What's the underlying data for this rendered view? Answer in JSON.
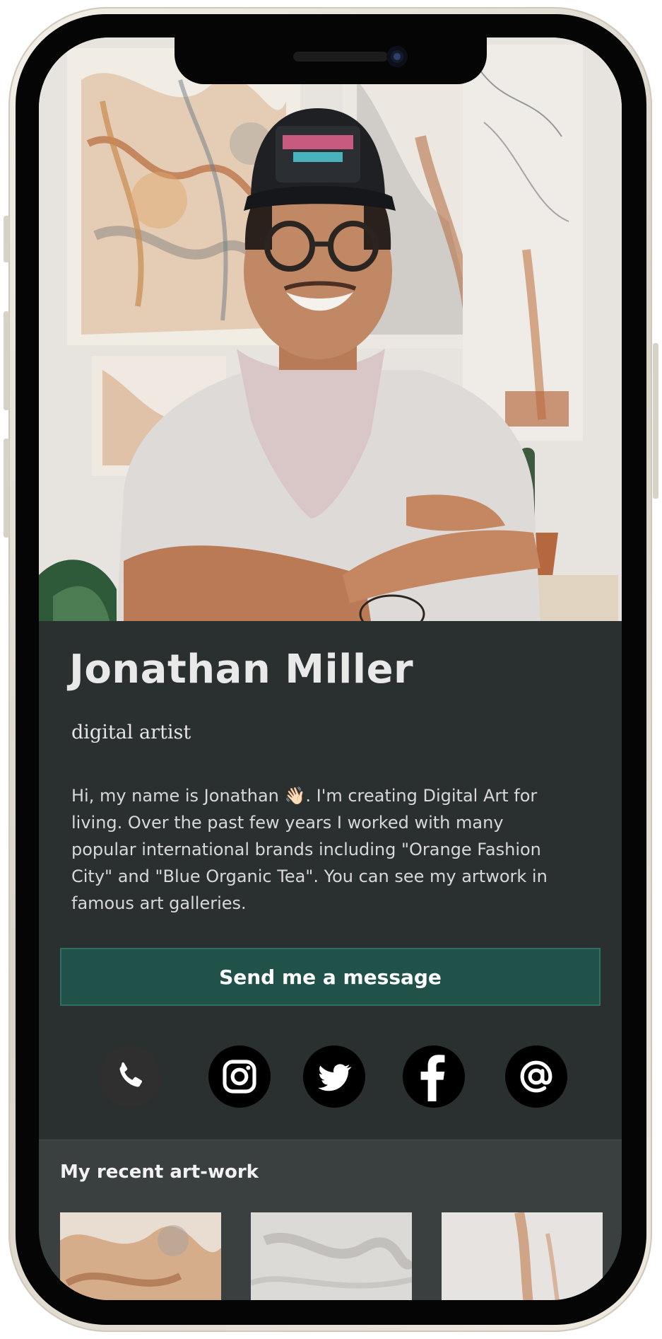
{
  "profile": {
    "name": "Jonathan Miller",
    "role": "digital artist",
    "bio": "Hi, my name is Jonathan 👋🏻. I'm creating Digital Art for living. Over the past few years I worked with many popular international brands  including \"Orange Fashion City\" and \"Blue Organic Tea\". You can see my artwork in famous art galleries.",
    "cta_label": "Send me a message"
  },
  "social": [
    {
      "name": "phone",
      "icon": "phone-icon"
    },
    {
      "name": "instagram",
      "icon": "instagram-icon"
    },
    {
      "name": "twitter",
      "icon": "twitter-icon"
    },
    {
      "name": "facebook",
      "icon": "facebook-icon"
    },
    {
      "name": "email",
      "icon": "at-sign-icon"
    }
  ],
  "recent": {
    "title": "My recent art-work",
    "thumbnails": [
      "artwork-1",
      "artwork-2",
      "artwork-3"
    ]
  },
  "colors": {
    "card_bg": "#2a2f30",
    "cta_bg": "#21524a",
    "recent_bg": "#3a3f40",
    "text": "#e9e9e9"
  }
}
